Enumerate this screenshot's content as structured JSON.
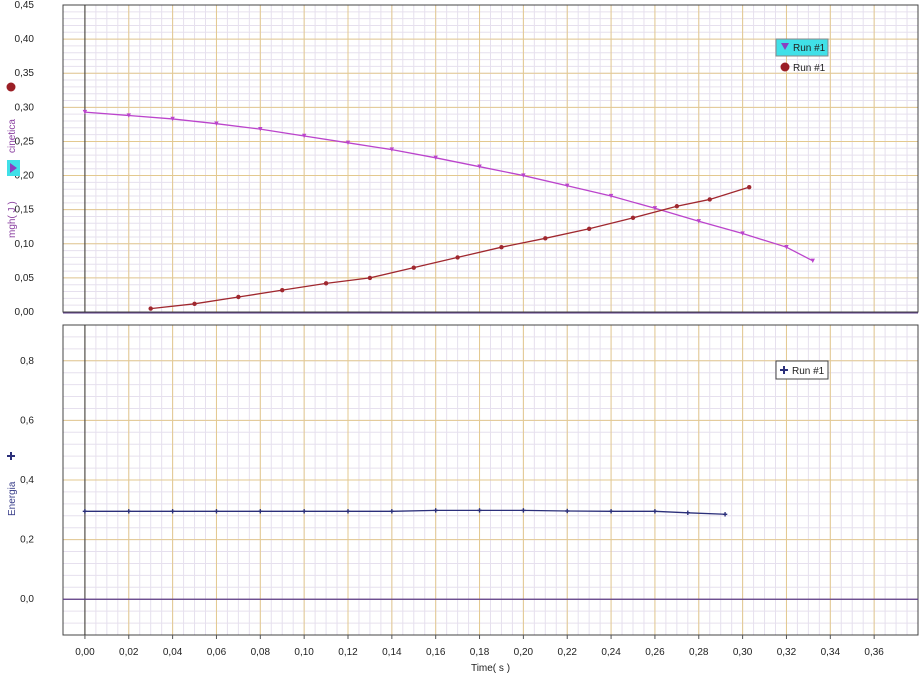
{
  "chart_data": [
    {
      "type": "line",
      "panel": "top",
      "ylabel_parts": [
        "mgh( J )",
        "cinetica"
      ],
      "ylim": [
        0,
        0.45
      ],
      "yticks": [
        0.0,
        0.05,
        0.1,
        0.15,
        0.2,
        0.25,
        0.3,
        0.35,
        0.4,
        0.45
      ],
      "ytick_labels": [
        "0,00",
        "0,05",
        "0,10",
        "0,15",
        "0,20",
        "0,25",
        "0,30",
        "0,35",
        "0,40",
        "0,45"
      ],
      "xlim": [
        -0.01,
        0.38
      ],
      "grid": true,
      "legend_position": "top-right",
      "series": [
        {
          "name": "Run #1",
          "marker": "triangle",
          "color": "#bb44cc",
          "x": [
            0.0,
            0.02,
            0.04,
            0.06,
            0.08,
            0.1,
            0.12,
            0.14,
            0.16,
            0.18,
            0.2,
            0.22,
            0.24,
            0.26,
            0.28,
            0.3,
            0.32,
            0.332
          ],
          "y": [
            0.293,
            0.288,
            0.283,
            0.276,
            0.268,
            0.258,
            0.248,
            0.238,
            0.226,
            0.213,
            0.2,
            0.185,
            0.17,
            0.152,
            0.133,
            0.115,
            0.095,
            0.075
          ]
        },
        {
          "name": "Run #1",
          "marker": "circle",
          "color": "#a0282f",
          "x": [
            0.03,
            0.05,
            0.07,
            0.09,
            0.11,
            0.13,
            0.15,
            0.17,
            0.19,
            0.21,
            0.23,
            0.25,
            0.27,
            0.285,
            0.303
          ],
          "y": [
            0.005,
            0.012,
            0.022,
            0.032,
            0.042,
            0.05,
            0.065,
            0.08,
            0.095,
            0.108,
            0.122,
            0.138,
            0.155,
            0.165,
            0.183
          ]
        }
      ]
    },
    {
      "type": "line",
      "panel": "bottom",
      "ylabel": "Energia",
      "ylim": [
        -0.12,
        0.92
      ],
      "yticks": [
        0.0,
        0.2,
        0.4,
        0.6,
        0.8
      ],
      "ytick_labels": [
        "0,0",
        "0,2",
        "0,4",
        "0,6",
        "0,8"
      ],
      "xlabel": "Time( s )",
      "xlim": [
        -0.01,
        0.38
      ],
      "xticks": [
        0.0,
        0.02,
        0.04,
        0.06,
        0.08,
        0.1,
        0.12,
        0.14,
        0.16,
        0.18,
        0.2,
        0.22,
        0.24,
        0.26,
        0.28,
        0.3,
        0.32,
        0.34,
        0.36
      ],
      "xtick_labels": [
        "0,00",
        "0,02",
        "0,04",
        "0,06",
        "0,08",
        "0,10",
        "0,12",
        "0,14",
        "0,16",
        "0,18",
        "0,20",
        "0,22",
        "0,24",
        "0,26",
        "0,28",
        "0,30",
        "0,32",
        "0,34",
        "0,36"
      ],
      "grid": true,
      "legend_position": "top-right",
      "series": [
        {
          "name": "Run #1",
          "marker": "plus",
          "color": "#2b2f7a",
          "x": [
            0.0,
            0.02,
            0.04,
            0.06,
            0.08,
            0.1,
            0.12,
            0.14,
            0.16,
            0.18,
            0.2,
            0.22,
            0.24,
            0.26,
            0.275,
            0.292
          ],
          "y": [
            0.295,
            0.295,
            0.295,
            0.295,
            0.295,
            0.295,
            0.295,
            0.295,
            0.298,
            0.298,
            0.298,
            0.296,
            0.295,
            0.295,
            0.29,
            0.285
          ]
        }
      ]
    }
  ]
}
